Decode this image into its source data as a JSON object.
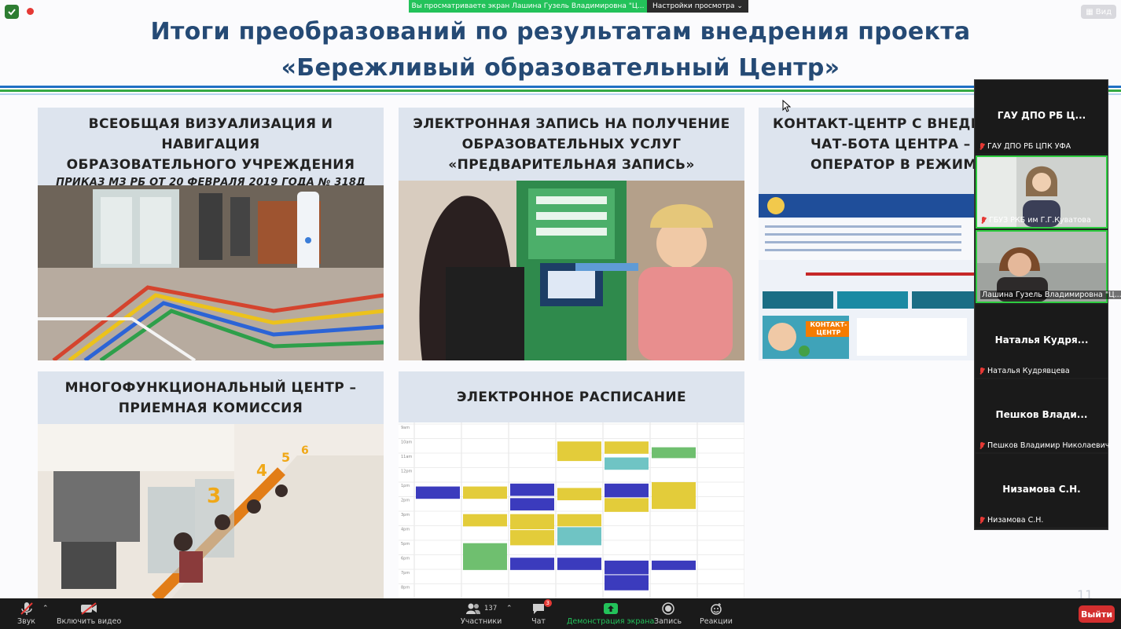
{
  "top_bar": {
    "shield_icon": "shield-check-icon",
    "share_banner_text": "Вы просматриваете экран Лашина Гузель Владимировна \"Ц...",
    "view_options_label": "Настройки просмотра ⌄",
    "view_button_label": "Вид",
    "colors": {
      "banner_green": "#23c25a",
      "banner_dark": "#2b2b2b"
    }
  },
  "slide": {
    "title_line1": "Итоги преобразований по результатам внедрения проекта",
    "title_line2": "«Бережливый образовательный Центр»",
    "cards": [
      {
        "line1": "ВСЕОБЩАЯ ВИЗУАЛИЗАЦИЯ И НАВИГАЦИЯ",
        "line2": "ОБРАЗОВАТЕЛЬНОГО УЧРЕЖДЕНИЯ",
        "sub": "ПРИКАЗ МЗ РБ ОТ 20 ФЕВРАЛЯ 2019 ГОДА № 318Д"
      },
      {
        "line1": "ЭЛЕКТРОННАЯ ЗАПИСЬ НА ПОЛУЧЕНИЕ",
        "line2": "ОБРАЗОВАТЕЛЬНЫХ УСЛУГ",
        "line3": "«ПРЕДВАРИТЕЛЬНАЯ ЗАПИСЬ»"
      },
      {
        "line1": "КОНТАКТ-ЦЕНТР С ВНЕДРЕ",
        "line2": "ЧАТ-БОТА ЦЕНТРА – ВИ",
        "line3": "ОПЕРАТОР В РЕЖИМЕ Р",
        "contact_badge": "КОНТАКТ-ЦЕНТР"
      },
      {
        "line1": "МНОГОФУНКЦИОНАЛЬНЫЙ ЦЕНТР –",
        "line2": "ПРИЕМНАЯ КОМИССИЯ"
      },
      {
        "line1": "ЭЛЕКТРОННОЕ РАСПИСАНИЕ"
      }
    ],
    "schedule_hours": [
      "9am",
      "10am",
      "11am",
      "12pm",
      "1pm",
      "2pm",
      "3pm",
      "4pm",
      "5pm",
      "6pm",
      "7pm",
      "8pm"
    ],
    "page_number": "11",
    "colors": {
      "title": "#254a75",
      "card_bg": "#dde4ee"
    }
  },
  "participants": [
    {
      "tile_name": "ГАУ ДПО РБ Ц...",
      "label": "ГАУ ДПО РБ ЦПК УФА",
      "video": false
    },
    {
      "tile_name": "",
      "label": "ГБУЗ РКБ им Г.Г.Куватова",
      "video": true
    },
    {
      "tile_name": "",
      "label": "Лашина Гузель Владимировна \"Ц...",
      "video": true,
      "active_speaker": true
    },
    {
      "tile_name": "Наталья  Кудря...",
      "label": "Наталья Кудрявцева",
      "video": false
    },
    {
      "tile_name": "Пешков  Влади...",
      "label": "Пешков Владимир Николаевич",
      "video": false
    },
    {
      "tile_name": "Низамова С.Н.",
      "label": "Низамова С.Н.",
      "video": false
    }
  ],
  "toolbar": {
    "audio_label": "Звук",
    "video_label": "Включить видео",
    "participants_label": "Участники",
    "participants_count": "137",
    "chat_label": "Чат",
    "chat_badge": "3",
    "share_label": "Демонстрация экрана",
    "record_label": "Запись",
    "reactions_label": "Реакции",
    "leave_label": "Выйти",
    "colors": {
      "share_green": "#23c25a",
      "leave_red": "#d32f2f"
    }
  }
}
